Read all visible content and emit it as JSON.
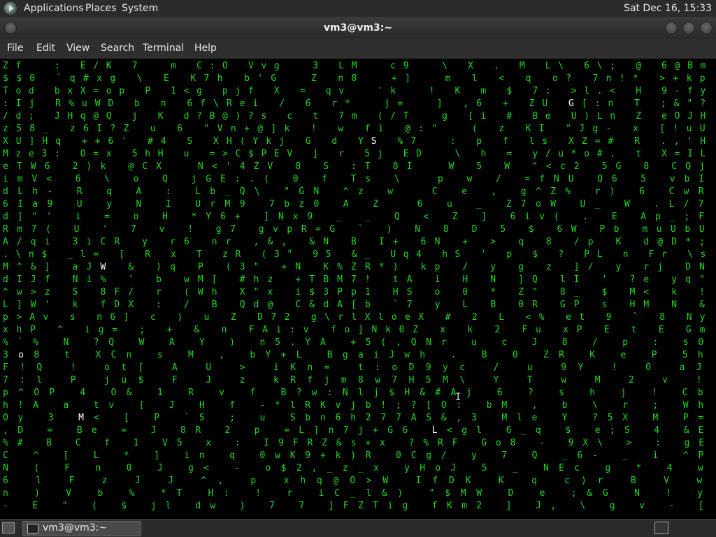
{
  "topbar": {
    "menus": [
      "Applications",
      "Places",
      "System"
    ],
    "clock": "Sat Dec 16, 15:33"
  },
  "window": {
    "title": "vm3@vm3:~",
    "menus": [
      "File",
      "Edit",
      "View",
      "Search",
      "Terminal",
      "Help"
    ]
  },
  "taskbar": {
    "task_label": "vm3@vm3:~"
  },
  "terminal": {
    "program_output_color": "#1fd81f",
    "highlight_color": "#ffffff",
    "rows": [
      "Zf  : E/K 7  m C:O Vvg  3 LM  c9  \\ X . M L\\ 6\\; @ 6@Bm",
      "$$0 `q#xg \\ E K7h b'G  Z n8  +]  m l < q o? 7n!* >+kp",
      "Tod bxX=op P 1<g pjf X = qv  'k  ! K m $ 7: >l.< H 9-fy",
      ":Ij R%uWD b n 6f\\Rei / 6 r*  j=  ] ,6 + ZU G[:n T ;&\"?",
      "/d; JHq@Q j K d?B@)?s c t 7m (/T  g [i # Be U)Ln Z eOJH",
      "z58_ z6I?Z u 6 \"Vn+@]k ! w fi @:\"  ( z KI \"Jg- x [!uU",
      "XU]Hq ++6' #4 S XH(Ykj G d YS %7  : p f ls XZ=# R .,'H",
      "Mze3: O=x 5hH u =>C$PEV ] r 5j ED  \\ h = y/u*o#. t X=IL",
      "eTW6 2)k @CX  N<'4ZV 8 S :T 8I  W 5 W \"<c2 5G 8 CQj",
      "imV< 6 \\ o Q jGE:.( 0 f Ts \\  p w / =fNU Q6 5 vbI",
      "dLh- R q A : Lb_Q\\ \"GN ^z w  C e , g^Z% r) 6 CwR",
      "6Ia9 U y N I UrM9 7bz0 A Z  6 u _ Z7oW U_ W .L/7",
      "d]\"' i = o H *Y6+ ]Nx9 _ _ Q < Z ] 6iv( . E Ap_;F",
      "Rm7( U ' 7 v ! g7 gvpR=G ` ) N 8 D 5 $ 6W Pb muUbU",
      "A/qi 3iCR y r6 nr ,&, &N B I+ 6N + > q 8 /p K d@D*;",
      ".\\n$ _l= [ R x T zR (3\" 95 &_ Uq4 hS ' p $ ? PL n Fr \\s",
      "M^&] aJW & )q P (3\" +N K%ZR*) kp / y g z ]/ y rj DN",
      "dIJf Ni% ' b wM[ #hz +TBM7! tA i H N ]Q lI ' ?e yq\"",
      "^w>z S 8F/ r (Wh X\"x i$3Pp1 HS o 0 * Z\" 8_ $ M< k !",
      "L]W' k fDX : / B Qd@ C&dA[b `7 y L B 0R GP s HM N &",
      "p>Av s n6] c ) u Z D72 g\\rlXloeX # 2 L <% et 9 ` 8 Ny",
      "xhP ^ ig= ; + & n FAi:v fo]Nk0Z x k 2 Fu xP E t E Gm",
      "%`% N ?Q W A Y ) n5.YA +5(,QNr u c J 8 / p : s0",
      "3o8 t XCn s M , bY+L BgaiJwh . B 0 ZR K e P 5h",
      "F!Q ! ot[ A U > iKn= t:oD9yc / u 9Y ! O aJ",
      "7:l P ju$ F J z kRfjm8w7H5M\\ Y T w M 2 v !",
      "p^OP 4 O& 1 R v f B?w:Nlj$H&#Aj 6 ? s h j ! Cb",
      "h!A a tv [ J H f -*lRKvjb!;?[O: bM , b \\ r ; Wh",
      "Oy 3 M< [ P `S ; u Sbn6h277AS&,3 Mle Y ?5X M P=",
      ",D = Be = J 8R 2 p =L]n7j+G6 L<gl 6_q $ e;S 4 &E",
      "%# B C f 1 V5 x : I9FRZ&s+x ?%RF Go8 - 9X\\ > : gE",
      "C ^ [ L * ] in q 0wK9+k)R 0Cg/ y 7 Q _6- _ i ^P",
      "N ( F n 0 J g< - o$2,_z_x yHoJ 5 _ NEc g * 4 w",
      "6 l F z J J ^, p xhq@O>W IfDK K q c)r B V w",
      "n ) V b % *T H: ! r iC_l&) \"$MW D e ;&G N ! y",
      "- E \" ( $ jl dw ) 7 7 ]FZTig fKm2 ] J, \\ g v - ["
    ]
  }
}
